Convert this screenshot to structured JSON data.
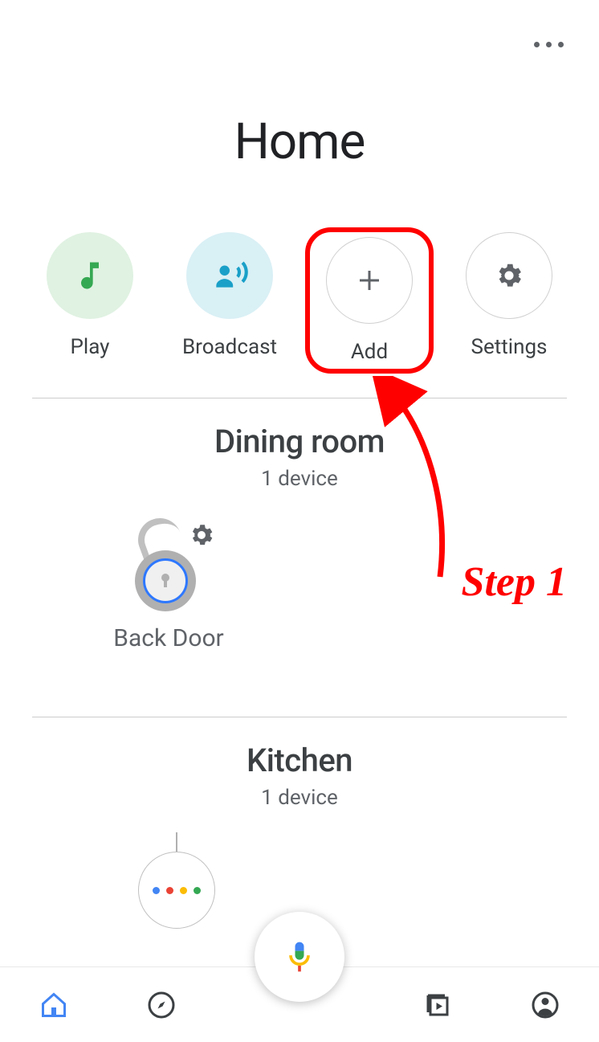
{
  "page": {
    "title": "Home"
  },
  "actions": {
    "play": "Play",
    "broadcast": "Broadcast",
    "add": "Add",
    "settings": "Settings"
  },
  "rooms": [
    {
      "name": "Dining room",
      "subtitle": "1 device",
      "device_name": "Back Door"
    },
    {
      "name": "Kitchen",
      "subtitle": "1 device"
    }
  ],
  "annotation": {
    "step_label": "Step 1"
  }
}
